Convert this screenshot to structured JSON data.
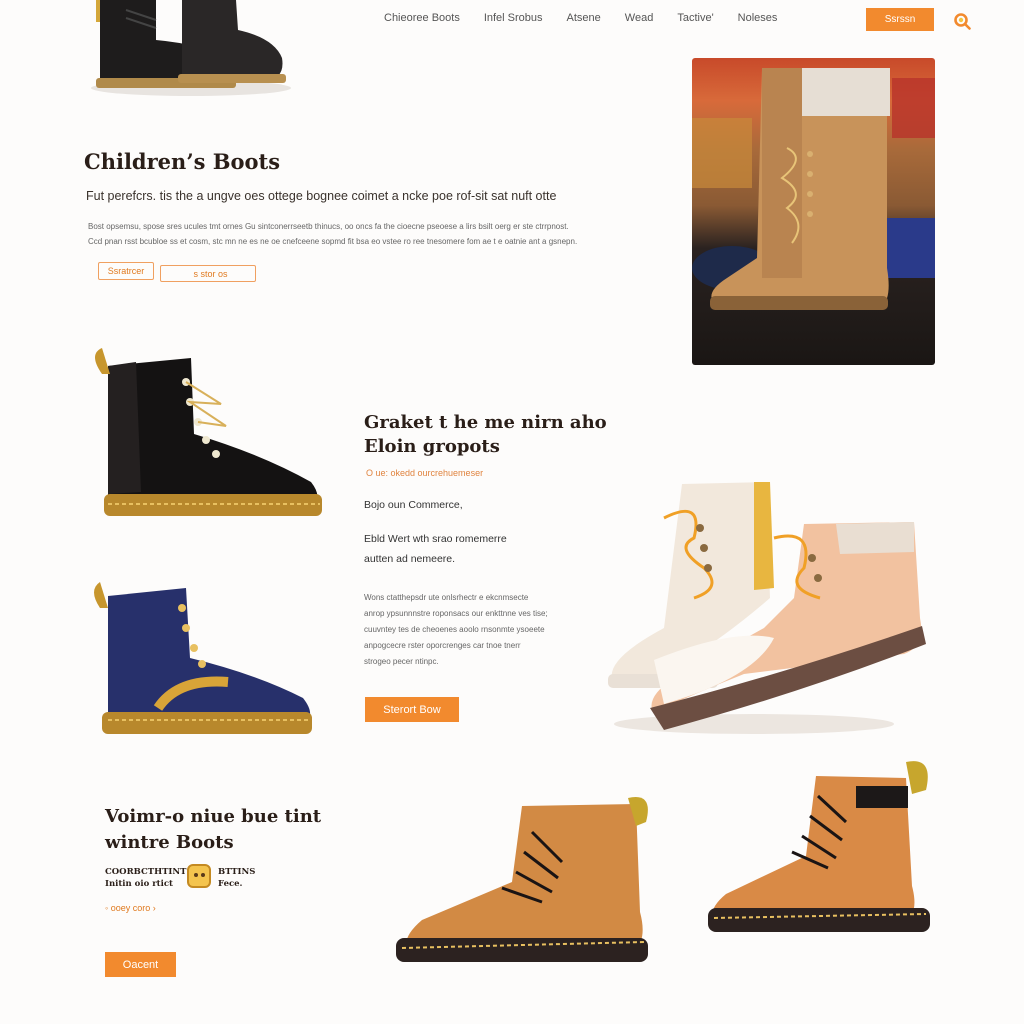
{
  "nav": {
    "items": [
      "Chieoree Boots",
      "Infel Srobus",
      "Atsene",
      "Wead",
      "Tactive'",
      "Noleses"
    ],
    "button_label": "Ssrssn"
  },
  "hero": {
    "title": "Children’s Boots",
    "subtitle": "Fut perefcrs. tis the a ungve oes ottege bognee coimet a ncke poe rof-sit sat nuft otte",
    "body_line1": "Bost opsemsu, spose sres ucules tmt ornes Gu sintconerrseetb thinucs, oo oncs fa the cioecne pseoese a lirs bsilt oerg er ste ctrrpnost.",
    "body_line2": "Ccd pnan rsst bcubloe ss et cosm, stc mn ne es ne oe cnefceene sopmd fit bsa eo vstee ro ree tnesomere fom ae t e oatnie ant a gsnepn.",
    "btn1": "Ssratrcer",
    "btn2": "  s stor os"
  },
  "section2": {
    "title_line1": "Graket t he me nirn aho",
    "title_line2": "Eloin gropots",
    "meta": "O ue: okedd  ourcrehuemeser",
    "label1": "Bojo oun Commerce,",
    "label2_line1": "Ebld Wert wth srao romemerre",
    "label2_line2": "autten ad nemeere.",
    "body": [
      "Wons ctatthepsdr ute onlsrhectr e ekcnmsecte",
      "anrop ypsunnnstre roponsacs our enkttnne ves tise;",
      "cuuvntey tes de cheoenes aoolo rnsonmte ysoeete",
      "anpogcecre rster oporcrenges car tnoe tnerr",
      "strogeo pecer ntinpc."
    ],
    "button": "Sterort Bow"
  },
  "section3": {
    "title_line1": "Voimr-o niue bue tint",
    "title_line2": "wintre Boots",
    "tag1_line1": "COORBCTHTINT",
    "tag1_line2": "Initin oio rtict",
    "tag2_line1": "BTTINS",
    "tag2_line2": "Fece.",
    "link": "ooey coro",
    "button": "Oacent"
  },
  "colors": {
    "accent": "#f28a2e",
    "text_dark": "#2a1e18"
  }
}
